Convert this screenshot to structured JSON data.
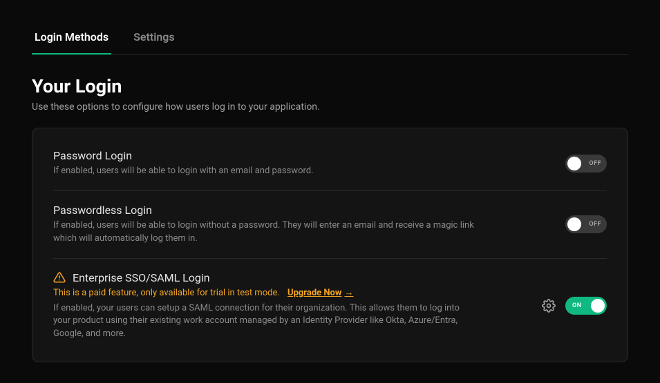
{
  "tabs": {
    "login_methods": "Login Methods",
    "settings": "Settings"
  },
  "header": {
    "title": "Your Login",
    "subtitle": "Use these options to configure how users log in to your application."
  },
  "rows": {
    "password": {
      "title": "Password Login",
      "desc": "If enabled, users will be able to login with an email and password.",
      "toggle_label": "OFF"
    },
    "passwordless": {
      "title": "Passwordless Login",
      "desc": "If enabled, users will be able to login without a password. They will enter an email and receive a magic link which will automatically log them in.",
      "toggle_label": "OFF"
    },
    "sso": {
      "title": "Enterprise SSO/SAML Login",
      "paid_notice": "This is a paid feature, only available for trial in test mode.",
      "upgrade": "Upgrade Now",
      "arrow": "→",
      "desc": "If enabled, your users can setup a SAML connection for their organization. This allows them to log into your product using their existing work account managed by an Identity Provider like Okta, Azure/Entra, Google, and more.",
      "toggle_label": "ON"
    }
  }
}
